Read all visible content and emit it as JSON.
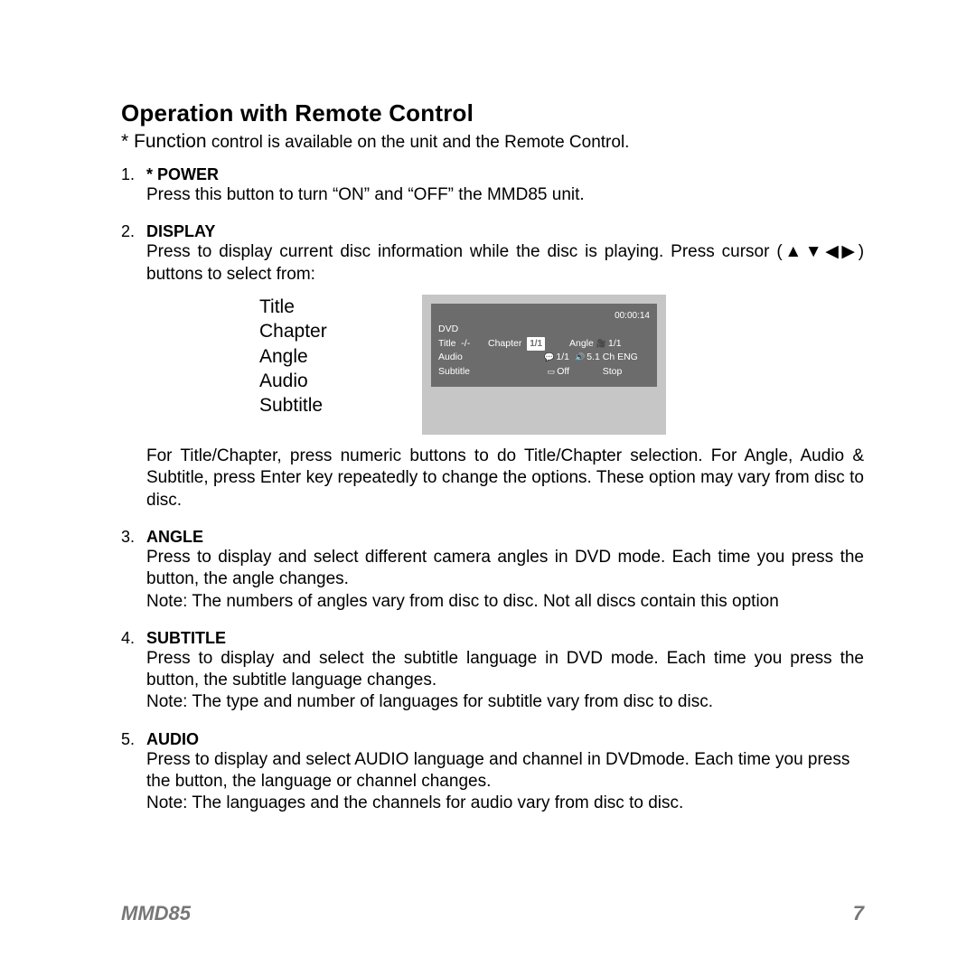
{
  "title": "Operation with Remote Control",
  "intro_prefix": "* Function",
  "intro_rest": " control is available on the unit and the Remote Control.",
  "sections": [
    {
      "num": "1.",
      "name": "* POWER",
      "body": "Press this button to turn “ON” and “OFF” the MMD85 unit."
    },
    {
      "num": "2.",
      "name": "DISPLAY",
      "body_pre": "Press to display current disc information while the disc is playing. Press cursor (",
      "body_arrows": "▲▼◀▶",
      "body_post": ") buttons to select from:",
      "list": [
        "Title",
        "Chapter",
        "Angle",
        "Audio",
        "Subtitle"
      ],
      "osd": {
        "time": "00:00:14",
        "dvd": "DVD",
        "title_label": "Title",
        "title_val": "-/-",
        "chapter_label": "Chapter",
        "chapter_val": "1/1",
        "angle_label": "Angle",
        "angle_val": "1/1",
        "audio_label": "Audio",
        "audio_icon": "1/1",
        "audio_val": "5.1 Ch ENG",
        "subtitle_label": "Subtitle",
        "subtitle_val": "Off",
        "status": "Stop"
      },
      "body_after": "For Title/Chapter, press numeric buttons to do Title/Chapter selection. For Angle, Audio & Subtitle, press Enter key repeatedly to change the options. These option may vary from disc to disc."
    },
    {
      "num": "3.",
      "name": "ANGLE",
      "body": "Press to display and select different camera angles in DVD mode. Each time you press the button, the angle changes.\nNote: The numbers of angles vary from disc to disc. Not all discs contain this option"
    },
    {
      "num": "4.",
      "name": "SUBTITLE",
      "body": "Press to display and select the subtitle language in DVD mode. Each time you press the button, the subtitle language changes.\nNote: The type and number of languages for subtitle vary from disc to disc."
    },
    {
      "num": "5.",
      "name": "AUDIO",
      "body": "Press to display and select  AUDIO language and channel in DVDmode. Each time you press the button, the language or channel changes.\nNote: The languages and the channels for audio vary from disc to disc."
    }
  ],
  "footer_model": "MMD85",
  "footer_page": "7"
}
